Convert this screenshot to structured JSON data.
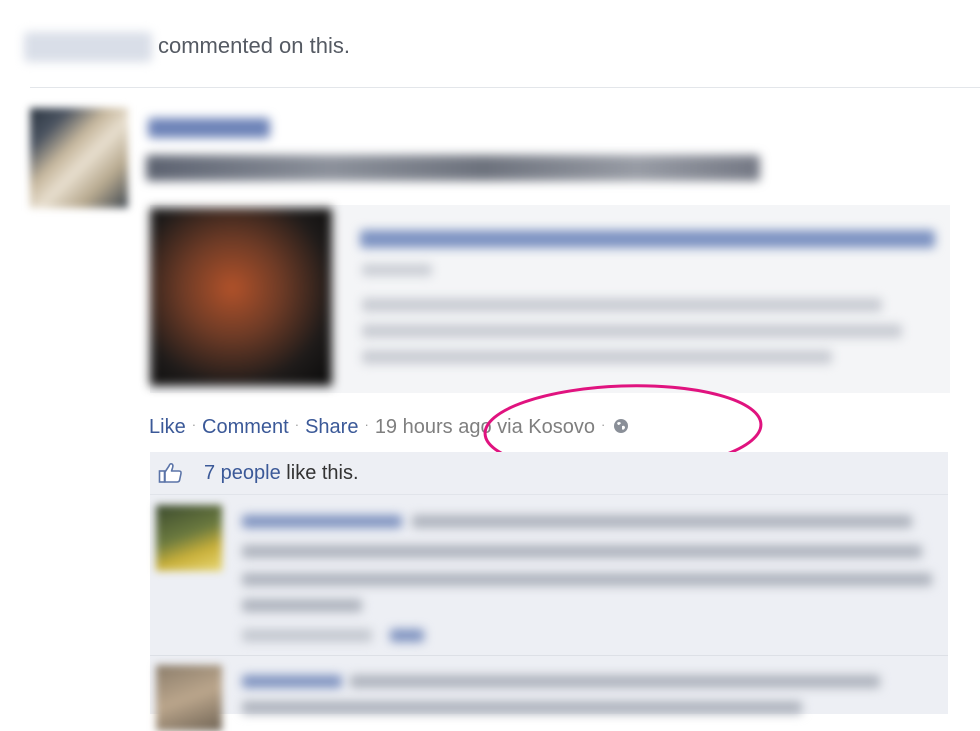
{
  "header": {
    "commented_text": "commented on this."
  },
  "post": {
    "actions": {
      "like": "Like",
      "comment": "Comment",
      "share": "Share",
      "timestamp": "19 hours ago via Kosovo",
      "separator": "·",
      "audience_icon": "globe-icon"
    }
  },
  "likes": {
    "count_link": "7 people",
    "suffix": " like this.",
    "icon": "thumbs-up-icon"
  },
  "colors": {
    "link": "#3b5998",
    "annotation": "#e0137f",
    "panel": "#edeff4"
  }
}
